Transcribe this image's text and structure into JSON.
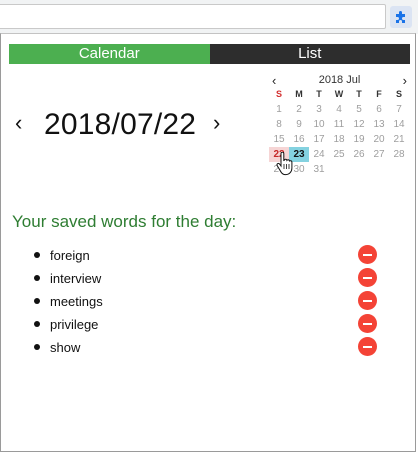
{
  "tabs": {
    "calendar_label": "Calendar",
    "list_label": "List"
  },
  "date_header": {
    "title": "2018/07/22",
    "prev_glyph": "‹",
    "next_glyph": "›"
  },
  "mini_calendar": {
    "month_label": "2018 Jul",
    "prev_glyph": "‹",
    "next_glyph": "›",
    "weekdays": [
      "S",
      "M",
      "T",
      "W",
      "T",
      "F",
      "S"
    ],
    "selected_day": "22",
    "today_day": "23",
    "weeks": [
      [
        "1",
        "2",
        "3",
        "4",
        "5",
        "6",
        "7"
      ],
      [
        "8",
        "9",
        "10",
        "11",
        "12",
        "13",
        "14"
      ],
      [
        "15",
        "16",
        "17",
        "18",
        "19",
        "20",
        "21"
      ],
      [
        "22",
        "23",
        "24",
        "25",
        "26",
        "27",
        "28"
      ],
      [
        "29",
        "30",
        "31",
        "",
        "",
        "",
        ""
      ]
    ]
  },
  "words_heading": "Your saved words for the day:",
  "saved_words": [
    "foreign",
    "interview",
    "meetings",
    "privilege",
    "show"
  ],
  "colors": {
    "calendar_tab": "#4caf50",
    "list_tab": "#2d2d2d",
    "heading": "#2e7d32",
    "remove_button": "#f44336",
    "selected_day_bg": "#f6d5d5",
    "today_bg": "#84d2e0"
  },
  "icons": {
    "extension": "puzzle-icon",
    "remove": "minus-icon",
    "pointer": "hand-cursor-icon"
  }
}
